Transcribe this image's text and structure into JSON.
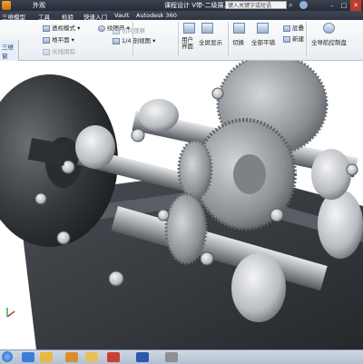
{
  "window": {
    "title": "课程设计 V带-二级展...",
    "search_placeholder": "键入关键字或短语",
    "quick_access_text": "外观"
  },
  "menu": {
    "items": [
      "三维模型",
      "工具",
      "检验",
      "快速入门",
      "Vault",
      "Autodesk 360"
    ]
  },
  "ribbon": {
    "left_top": "三维",
    "left_bottom": "窗",
    "view_style": "透视模式",
    "ground_plane": "地平面",
    "realistic": "光线跟踪",
    "shadow": "纹理开",
    "section_quarter": "切片观察",
    "section_ratio": "1/4 剖视图",
    "section_half": "半剖视图",
    "user_interface": "用户界面",
    "fullscreen": "全屏显示",
    "switch": "切换",
    "tile": "全部平铺",
    "cascade": "层叠",
    "new_window": "新建",
    "navigation": "全导航控制盘"
  },
  "colors": {
    "title_bar": "#2f3540",
    "ribbon_bg": "#f1f3f6",
    "viewport_bg": "#ffffff",
    "gear_metal": "#8f9499",
    "housing_cast": "#3a3d42",
    "taskbar_bg": "#c2ccd8"
  },
  "taskbar": {
    "icons": [
      "ie-icon",
      "explorer-icon",
      "media-icon",
      "folder-icon",
      "inventor-icon",
      "word-icon",
      "app-icon"
    ]
  }
}
